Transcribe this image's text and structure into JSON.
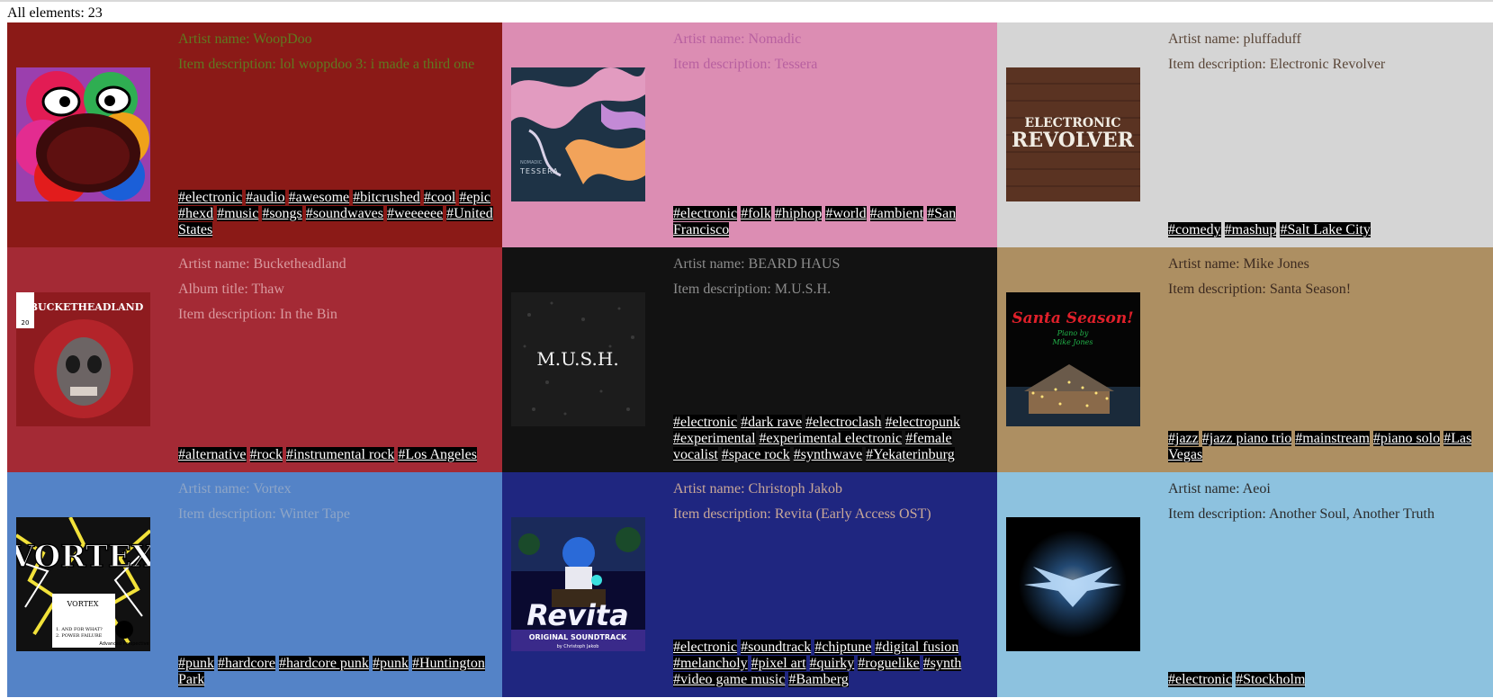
{
  "header": {
    "count_text": "All elements: 23"
  },
  "labels": {
    "artist": "Artist name: ",
    "album": "Album title: ",
    "description": "Item description: "
  },
  "cards": [
    {
      "bg": "#8b1a17",
      "text_color": "#5f7a20",
      "artist": "WoopDoo",
      "description": "lol woppdoo 3: i made a third one",
      "tags": [
        "#electronic",
        "#audio",
        "#awesome",
        "#bitcrushed",
        "#cool",
        "#epic",
        "#hexd",
        "#music",
        "#songs",
        "#soundwaves",
        "#weeeeee",
        "#United States"
      ]
    },
    {
      "bg": "#dc8db3",
      "text_color": "#b860a0",
      "artist": "Nomadic",
      "description": "Tessera",
      "art_text": "NOMADIC TESSERA",
      "tags": [
        "#electronic",
        "#folk",
        "#hiphop",
        "#world",
        "#ambient",
        "#San Francisco"
      ]
    },
    {
      "bg": "#d5d5d5",
      "text_color": "#5a4638",
      "artist": "pluffaduff",
      "description": "Electronic Revolver",
      "art_text": [
        "ELECTRONIC",
        "REVOLVER"
      ],
      "tags": [
        "#comedy",
        "#mashup",
        "#Salt Lake City"
      ]
    },
    {
      "bg": "#a42a35",
      "text_color": "#d99a9f",
      "artist": "Bucketheadland",
      "album": "Thaw",
      "description": "In the Bin",
      "art_text": "BUCKETHEADLAND",
      "art_badge": "20",
      "tags": [
        "#alternative",
        "#rock",
        "#instrumental rock",
        "#Los Angeles"
      ]
    },
    {
      "bg": "#121212",
      "text_color": "#8c8c8c",
      "artist": "BEARD HAUS",
      "description": "M.U.S.H.",
      "art_text": "M.U.S.H.",
      "tags": [
        "#electronic",
        "#dark rave",
        "#electroclash",
        "#electropunk",
        "#experimental",
        "#experimental electronic",
        "#female vocalist",
        "#space rock",
        "#synthwave",
        "#Yekaterinburg"
      ]
    },
    {
      "bg": "#ad8f62",
      "text_color": "#3c2a20",
      "artist": "Mike Jones",
      "description": "Santa Season!",
      "art_text": [
        "Santa Season!",
        "Piano by",
        "Mike Jones"
      ],
      "tags": [
        "#jazz",
        "#jazz piano trio",
        "#mainstream",
        "#piano solo",
        "#Las Vegas"
      ]
    },
    {
      "bg": "#5483c7",
      "text_color": "#8fa6c7",
      "artist": "Vortex",
      "description": "Winter Tape",
      "art_text": [
        "VORTEX",
        "VORTEX",
        "1. AND FOR WHAT?",
        "2. POWER FAILURE",
        "Advanced Perspective"
      ],
      "tags": [
        "#punk",
        "#hardcore",
        "#hardcore punk",
        "#punk",
        "#Huntington Park"
      ]
    },
    {
      "bg": "#1f2680",
      "text_color": "#c9a898",
      "artist": "Christoph Jakob",
      "description": "Revita (Early Access OST)",
      "art_text": [
        "Revita",
        "ORIGINAL SOUNDTRACK",
        "by Christoph Jakob"
      ],
      "tags": [
        "#electronic",
        "#soundtrack",
        "#chiptune",
        "#digital fusion",
        "#melancholy",
        "#pixel art",
        "#quirky",
        "#roguelike",
        "#synth",
        "#video game music",
        "#Bamberg"
      ]
    },
    {
      "bg": "#8dc2df",
      "text_color": "#2b2b2b",
      "artist": "Aeoi",
      "description": "Another Soul, Another Truth",
      "tags": [
        "#electronic",
        "#Stockholm"
      ]
    }
  ]
}
